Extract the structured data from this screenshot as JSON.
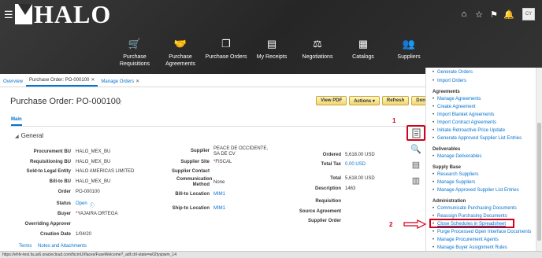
{
  "header": {
    "logo_text": "HALO",
    "avatar_initials": "CY",
    "top_icons": [
      "home-icon",
      "star-icon",
      "flag-icon",
      "bell-icon"
    ],
    "nav": [
      {
        "label": "Purchase Requisitions",
        "icon": "cart-icon"
      },
      {
        "label": "Purchase Agreements",
        "icon": "handshake-icon"
      },
      {
        "label": "Purchase Orders",
        "icon": "documents-icon"
      },
      {
        "label": "My Receipts",
        "icon": "receipt-icon"
      },
      {
        "label": "Negotiations",
        "icon": "negotiation-icon"
      },
      {
        "label": "Catalogs",
        "icon": "catalog-icon"
      },
      {
        "label": "Suppliers",
        "icon": "suppliers-icon"
      }
    ]
  },
  "tabs": {
    "overview": "Overview",
    "po": "Purchase Order: PO-000100",
    "manage": "Manage Orders"
  },
  "page": {
    "title": "Purchase Order: PO-000100",
    "buttons": {
      "view_pdf": "View PDF",
      "actions": "Actions ▾",
      "refresh": "Refresh",
      "done": "Done"
    },
    "subtab": "Main",
    "section": "General"
  },
  "fields_left": [
    {
      "label": "Procurement BU",
      "value": "HALO_MEX_BU"
    },
    {
      "label": "Requisitioning BU",
      "value": "HALO_MEX_BU"
    },
    {
      "label": "Sold-to Legal Entity",
      "value": "HALO AMERICAS LIMITED"
    },
    {
      "label": "Bill-to BU",
      "value": "HALO_MEX_BU"
    },
    {
      "label": "Order",
      "value": "PO-000100"
    },
    {
      "label": "Status",
      "value": "Open"
    },
    {
      "label": "Buyer",
      "value": "YAJAIRA ORTEGA"
    },
    {
      "label": "Overriding Approver",
      "value": ""
    },
    {
      "label": "Creation Date",
      "value": "1/04/20"
    }
  ],
  "fields_mid": [
    {
      "label": "Supplier",
      "value": "PEACE DE OCCIDENTE, SA DE CV"
    },
    {
      "label": "Supplier Site",
      "value": "FISCAL"
    },
    {
      "label": "Supplier Contact",
      "value": ""
    },
    {
      "label": "Communication Method",
      "value": "None"
    },
    {
      "label": "Bill-to Location",
      "value": "MIM1"
    },
    {
      "label": "Ship-to Location",
      "value": "MIM1"
    }
  ],
  "fields_right": [
    {
      "label": "Ordered",
      "value": "5,618.00 USD"
    },
    {
      "label": "Total Tax",
      "value": "0.00 USD"
    },
    {
      "label": "Total",
      "value": "5,618.00 USD"
    },
    {
      "label": "Description",
      "value": "1463"
    },
    {
      "label": "Requisition",
      "value": ""
    },
    {
      "label": "Source Agreement",
      "value": ""
    },
    {
      "label": "Supplier Order",
      "value": ""
    }
  ],
  "footer_tabs": [
    "Terms",
    "Notes and Attachments"
  ],
  "status_url": "https://ehfv-test.fa.us6.oraclecloud.com/fscmUI/faces/FuseWelcome?_adf.ctrl-state=w02tyspwm_14",
  "annotations": {
    "one": "1",
    "two": "2"
  },
  "tasks": {
    "top_items": [
      "Generate Orders",
      "Import Orders"
    ],
    "agreements_title": "Agreements",
    "agreements": [
      "Manage Agreements",
      "Create Agreement",
      "Import Blanket Agreements",
      "Import Contract Agreements",
      "Initiate Retroactive Price Update",
      "Generate Approved Supplier List Entries"
    ],
    "deliverables_title": "Deliverables",
    "deliverables": [
      "Manage Deliverables"
    ],
    "supply_base_title": "Supply Base",
    "supply_base": [
      "Research Suppliers",
      "Manage Suppliers",
      "Manage Approved Supplier List Entries"
    ],
    "administration_title": "Administration",
    "administration": [
      "Communicate Purchasing Documents",
      "Reassign Purchasing Documents",
      "Close Schedules in Spreadsheet",
      "Purge Processed Open Interface Documents",
      "Manage Procurement Agents",
      "Manage Buyer Assignment Rules"
    ]
  }
}
